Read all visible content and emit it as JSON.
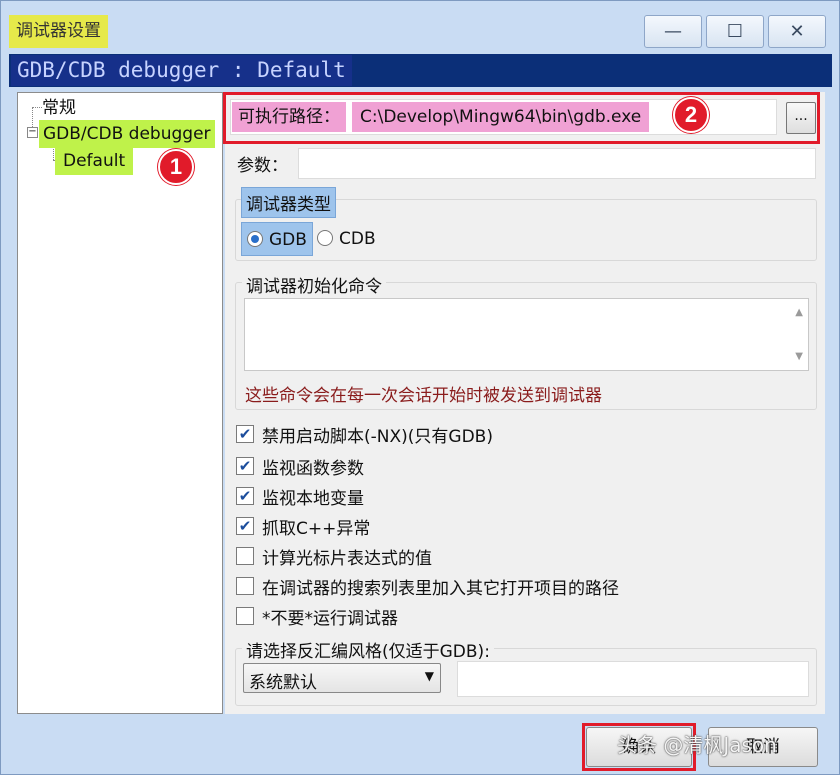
{
  "window": {
    "title": "调试器设置",
    "minimize_glyph": "—",
    "maximize_glyph": "☐",
    "close_glyph": "✕"
  },
  "header": {
    "text": "GDB/CDB debugger : Default"
  },
  "tree": {
    "items": [
      {
        "label": "常规"
      },
      {
        "label": "GDB/CDB debugger"
      },
      {
        "label": "Default"
      }
    ],
    "collapse_glyph": "−"
  },
  "annotations": {
    "badge1": "1",
    "badge2": "2"
  },
  "form": {
    "exe_path_label": "可执行路径：",
    "exe_path_value": "C:\\Develop\\Mingw64\\bin\\gdb.exe",
    "browse_label": "...",
    "args_label": "参数：",
    "args_value": "",
    "debugger_type_label": "调试器类型",
    "radio_gdb": "GDB",
    "radio_cdb": "CDB",
    "selected_type": "GDB",
    "init_commands_label": "调试器初始化命令",
    "init_commands_value": "",
    "init_commands_hint": "这些命令会在每一次会话开始时被发送到调试器",
    "checkboxes": [
      {
        "label": "禁用启动脚本(-NX)(只有GDB)",
        "checked": true
      },
      {
        "label": "监视函数参数",
        "checked": true
      },
      {
        "label": "监视本地变量",
        "checked": true
      },
      {
        "label": "抓取C++异常",
        "checked": true
      },
      {
        "label": "计算光标片表达式的值",
        "checked": false
      },
      {
        "label": "在调试器的搜索列表里加入其它打开项目的路径",
        "checked": false
      },
      {
        "label": "*不要*运行调试器",
        "checked": false
      }
    ],
    "disasm_label": "请选择反汇编风格(仅适于GDB):",
    "disasm_value": "系统默认",
    "disasm_extra_value": ""
  },
  "buttons": {
    "ok": "确认",
    "cancel": "取消"
  },
  "watermark": "头条 @清枫Jason",
  "colors": {
    "header_band": "#0b2f78",
    "tree_highlight": "#bff24a",
    "path_highlight": "#f0a1d4",
    "annotation_red": "#e11b2a"
  }
}
